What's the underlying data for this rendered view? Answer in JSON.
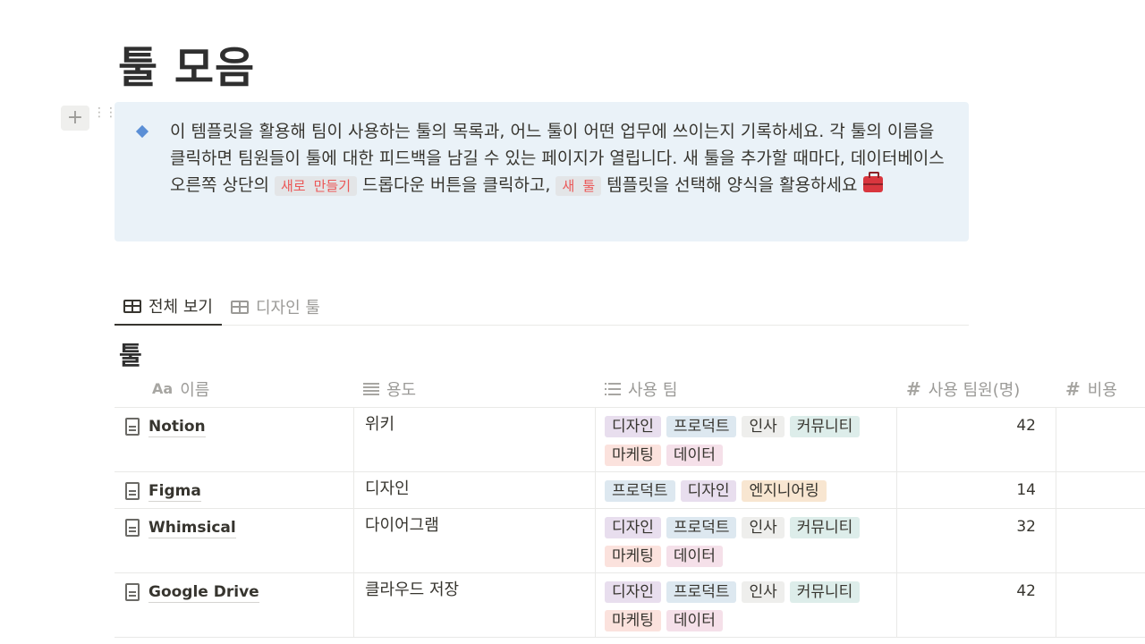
{
  "page": {
    "title": "툴 모음"
  },
  "callout": {
    "text_1": "이 템플릿을 활용해 팀이 사용하는 툴의 목록과, 어느 툴이 어떤 업무에 쓰이는지 기록하세요. 각 툴의 이름을 클릭하면 팀원들이 툴에 대한 피드백을 남길 수 있는 페이지가 열립니다. 새 툴을 추가할 때마다, 데이터베이스 오른쪽 상단의 ",
    "code_1": "새로 만들기",
    "text_2": " 드롭다운 버튼을 클릭하고, ",
    "code_2": "새 툴",
    "text_3": " 템플릿을 선택해 양식을 활용하세요 "
  },
  "tabs": [
    {
      "label": "전체 보기"
    },
    {
      "label": "디자인 툴"
    }
  ],
  "database": {
    "title": "툴",
    "columns": {
      "name": {
        "icon": "Aa",
        "label": "이름"
      },
      "use": {
        "label": "용도"
      },
      "team": {
        "label": "사용 팀"
      },
      "members": {
        "icon": "#",
        "label": "사용 팀원(명)"
      },
      "cost": {
        "icon": "#",
        "label": "비용"
      }
    },
    "rows": [
      {
        "name": "Notion",
        "use": "위키",
        "members": "42",
        "tags": [
          {
            "label": "디자인",
            "color": "#e8deee"
          },
          {
            "label": "프로덕트",
            "color": "#dde8f0"
          },
          {
            "label": "인사",
            "color": "#eeeeec"
          },
          {
            "label": "커뮤니티",
            "color": "#ddedea"
          },
          {
            "label": "마케팅",
            "color": "#fbe2dd"
          },
          {
            "label": "데이터",
            "color": "#f5e0e9"
          }
        ]
      },
      {
        "name": "Figma",
        "use": "디자인",
        "members": "14",
        "tags": [
          {
            "label": "프로덕트",
            "color": "#dde8f0"
          },
          {
            "label": "디자인",
            "color": "#e8deee"
          },
          {
            "label": "엔지니어링",
            "color": "#f8e6d1"
          }
        ]
      },
      {
        "name": "Whimsical",
        "use": "다이어그램",
        "members": "32",
        "tags": [
          {
            "label": "디자인",
            "color": "#e8deee"
          },
          {
            "label": "프로덕트",
            "color": "#dde8f0"
          },
          {
            "label": "인사",
            "color": "#eeeeec"
          },
          {
            "label": "커뮤니티",
            "color": "#ddedea"
          },
          {
            "label": "마케팅",
            "color": "#fbe2dd"
          },
          {
            "label": "데이터",
            "color": "#f5e0e9"
          }
        ]
      },
      {
        "name": "Google Drive",
        "use": "클라우드 저장",
        "members": "42",
        "tags": [
          {
            "label": "디자인",
            "color": "#e8deee"
          },
          {
            "label": "프로덕트",
            "color": "#dde8f0"
          },
          {
            "label": "인사",
            "color": "#eeeeec"
          },
          {
            "label": "커뮤니티",
            "color": "#ddedea"
          },
          {
            "label": "마케팅",
            "color": "#fbe2dd"
          },
          {
            "label": "데이터",
            "color": "#f5e0e9"
          }
        ]
      }
    ]
  }
}
